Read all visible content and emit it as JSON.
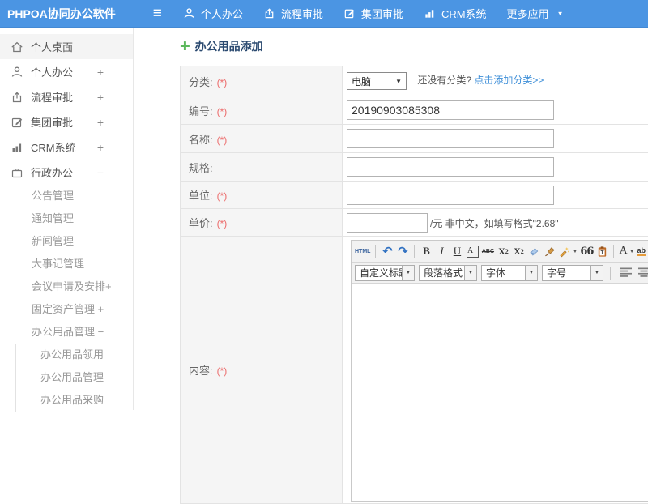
{
  "colors": {
    "navbar_blue": "#4B95E3",
    "link_blue": "#3F8FD8",
    "required_red": "#EC6C6C",
    "title_navy": "#2B4A70",
    "plus_green": "#5CB85C",
    "label_bg": "#F5F5F5",
    "border": "#E3E3E3"
  },
  "icons": {
    "hamburger": "≡",
    "caret_down": "▼",
    "select_caret": "▼",
    "undo": "↶",
    "redo": "↷",
    "plus": "✚"
  },
  "navbar": {
    "brand": "PHPOA协同办公软件",
    "items": [
      {
        "label": "个人办公"
      },
      {
        "label": "流程审批"
      },
      {
        "label": "集团审批"
      },
      {
        "label": "CRM系统"
      },
      {
        "label": "更多应用"
      }
    ]
  },
  "sidebar": {
    "items": [
      {
        "label": "个人桌面",
        "expand": ""
      },
      {
        "label": "个人办公",
        "expand": "+"
      },
      {
        "label": "流程审批",
        "expand": "+"
      },
      {
        "label": "集团审批",
        "expand": "+"
      },
      {
        "label": "CRM系统",
        "expand": "+"
      },
      {
        "label": "行政办公",
        "expand": "−"
      }
    ],
    "admin_children": [
      "公告管理",
      "通知管理",
      "新闻管理",
      "大事记管理",
      "会议申请及安排+",
      "固定资产管理 +",
      "办公用品管理 −"
    ],
    "supplies_children": [
      "办公用品领用",
      "办公用品管理",
      "办公用品采购"
    ]
  },
  "main": {
    "title": "办公用品添加"
  },
  "form": {
    "rows": [
      {
        "label": "分类:",
        "req": "(*)"
      },
      {
        "label": "编号:",
        "req": "(*)"
      },
      {
        "label": "名称:",
        "req": "(*)"
      },
      {
        "label": "规格:",
        "req": ""
      },
      {
        "label": "单位:",
        "req": "(*)"
      },
      {
        "label": "单价:",
        "req": "(*)"
      },
      {
        "label": "内容:",
        "req": "(*)"
      }
    ],
    "category": {
      "value": "电脑",
      "hint": "还没有分类? ",
      "link": "点击添加分类>>"
    },
    "code_value": "20190903085308",
    "price_suffix": "/元 非中文，如填写格式\"2.68\""
  },
  "editor": {
    "t1": {
      "html": "HTML",
      "bold": "B",
      "italic": "I",
      "underline": "U",
      "fontbox": "A",
      "strike": "ABC",
      "x": "X",
      "sup": "2",
      "sub": "2",
      "quote": "66",
      "fontcolor": "A",
      "highlight": "ab"
    },
    "t2": {
      "selects": [
        "自定义标题",
        "段落格式",
        "字体",
        "字号"
      ]
    }
  }
}
